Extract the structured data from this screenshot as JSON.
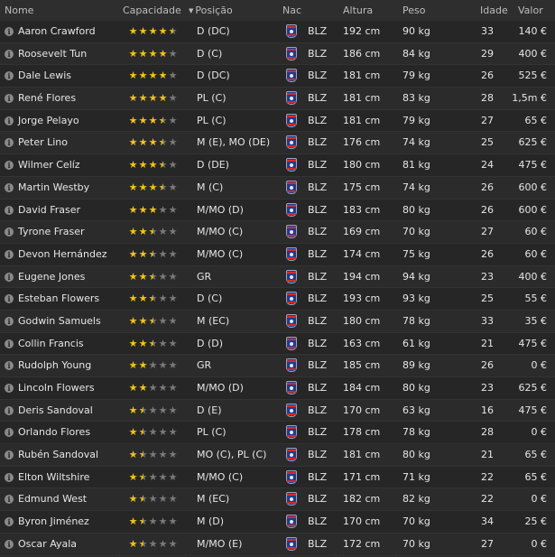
{
  "header": {
    "name": "Nome",
    "ability": "Capacidade",
    "position": "Posição",
    "nationality": "Nac",
    "height": "Altura",
    "weight": "Peso",
    "age": "Idade",
    "value": "Valor"
  },
  "colors": {
    "star": "#f3c417",
    "star_empty": "#7a7a7a",
    "flag_blue": "#1d3c8f",
    "flag_red": "#d42b2b"
  },
  "rows": [
    {
      "name": "Aaron Crawford",
      "stars": 4.5,
      "pos": "D (DC)",
      "nat": "BLZ",
      "height": "192 cm",
      "weight": "90 kg",
      "age": "33",
      "value": "140 €"
    },
    {
      "name": "Roosevelt Tun",
      "stars": 4,
      "pos": "D (C)",
      "nat": "BLZ",
      "height": "186 cm",
      "weight": "84 kg",
      "age": "29",
      "value": "400 €"
    },
    {
      "name": "Dale Lewis",
      "stars": 4,
      "pos": "D (DC)",
      "nat": "BLZ",
      "height": "181 cm",
      "weight": "79 kg",
      "age": "26",
      "value": "525 €"
    },
    {
      "name": "René Flores",
      "stars": 4,
      "pos": "PL (C)",
      "nat": "BLZ",
      "height": "181 cm",
      "weight": "83 kg",
      "age": "28",
      "value": "1,5m €"
    },
    {
      "name": "Jorge Pelayo",
      "stars": 3.5,
      "pos": "PL (C)",
      "nat": "BLZ",
      "height": "181 cm",
      "weight": "79 kg",
      "age": "27",
      "value": "65 €"
    },
    {
      "name": "Peter Lino",
      "stars": 3.5,
      "pos": "M (E), MO (DE)",
      "nat": "BLZ",
      "height": "176 cm",
      "weight": "74 kg",
      "age": "25",
      "value": "625 €"
    },
    {
      "name": "Wilmer Celíz",
      "stars": 3.5,
      "pos": "D (DE)",
      "nat": "BLZ",
      "height": "180 cm",
      "weight": "81 kg",
      "age": "24",
      "value": "475 €"
    },
    {
      "name": "Martin Westby",
      "stars": 3.5,
      "pos": "M (C)",
      "nat": "BLZ",
      "height": "175 cm",
      "weight": "74 kg",
      "age": "26",
      "value": "600 €"
    },
    {
      "name": "David Fraser",
      "stars": 3,
      "pos": "M/MO (D)",
      "nat": "BLZ",
      "height": "183 cm",
      "weight": "80 kg",
      "age": "26",
      "value": "600 €"
    },
    {
      "name": "Tyrone Fraser",
      "stars": 2.5,
      "pos": "M/MO (C)",
      "nat": "BLZ",
      "height": "169 cm",
      "weight": "70 kg",
      "age": "27",
      "value": "60 €"
    },
    {
      "name": "Devon Hernández",
      "stars": 2.5,
      "pos": "M/MO (C)",
      "nat": "BLZ",
      "height": "174 cm",
      "weight": "75 kg",
      "age": "26",
      "value": "60 €"
    },
    {
      "name": "Eugene Jones",
      "stars": 2.5,
      "pos": "GR",
      "nat": "BLZ",
      "height": "194 cm",
      "weight": "94 kg",
      "age": "23",
      "value": "400 €"
    },
    {
      "name": "Esteban Flowers",
      "stars": 2.5,
      "pos": "D (C)",
      "nat": "BLZ",
      "height": "193 cm",
      "weight": "93 kg",
      "age": "25",
      "value": "55 €"
    },
    {
      "name": "Godwin Samuels",
      "stars": 2.5,
      "pos": "M (EC)",
      "nat": "BLZ",
      "height": "180 cm",
      "weight": "78 kg",
      "age": "33",
      "value": "35 €"
    },
    {
      "name": "Collin Francis",
      "stars": 2.5,
      "pos": "D (D)",
      "nat": "BLZ",
      "height": "163 cm",
      "weight": "61 kg",
      "age": "21",
      "value": "475 €"
    },
    {
      "name": "Rudolph Young",
      "stars": 2,
      "pos": "GR",
      "nat": "BLZ",
      "height": "185 cm",
      "weight": "89 kg",
      "age": "26",
      "value": "0 €"
    },
    {
      "name": "Lincoln Flowers",
      "stars": 2,
      "pos": "M/MO (D)",
      "nat": "BLZ",
      "height": "184 cm",
      "weight": "80 kg",
      "age": "23",
      "value": "625 €"
    },
    {
      "name": "Deris Sandoval",
      "stars": 1.5,
      "pos": "D (E)",
      "nat": "BLZ",
      "height": "170 cm",
      "weight": "63 kg",
      "age": "16",
      "value": "475 €"
    },
    {
      "name": "Orlando Flores",
      "stars": 1.5,
      "pos": "PL (C)",
      "nat": "BLZ",
      "height": "178 cm",
      "weight": "78 kg",
      "age": "28",
      "value": "0 €"
    },
    {
      "name": "Rubén Sandoval",
      "stars": 1.5,
      "pos": "MO (C), PL (C)",
      "nat": "BLZ",
      "height": "181 cm",
      "weight": "80 kg",
      "age": "21",
      "value": "65 €"
    },
    {
      "name": "Elton Wiltshire",
      "stars": 1.5,
      "pos": "M/MO (C)",
      "nat": "BLZ",
      "height": "171 cm",
      "weight": "71 kg",
      "age": "22",
      "value": "65 €"
    },
    {
      "name": "Edmund West",
      "stars": 1.5,
      "pos": "M (EC)",
      "nat": "BLZ",
      "height": "182 cm",
      "weight": "82 kg",
      "age": "22",
      "value": "0 €"
    },
    {
      "name": "Byron Jiménez",
      "stars": 1.5,
      "pos": "M (D)",
      "nat": "BLZ",
      "height": "170 cm",
      "weight": "70 kg",
      "age": "34",
      "value": "25 €"
    },
    {
      "name": "Oscar Ayala",
      "stars": 1.5,
      "pos": "M/MO (E)",
      "nat": "BLZ",
      "height": "172 cm",
      "weight": "70 kg",
      "age": "27",
      "value": "0 €"
    }
  ]
}
